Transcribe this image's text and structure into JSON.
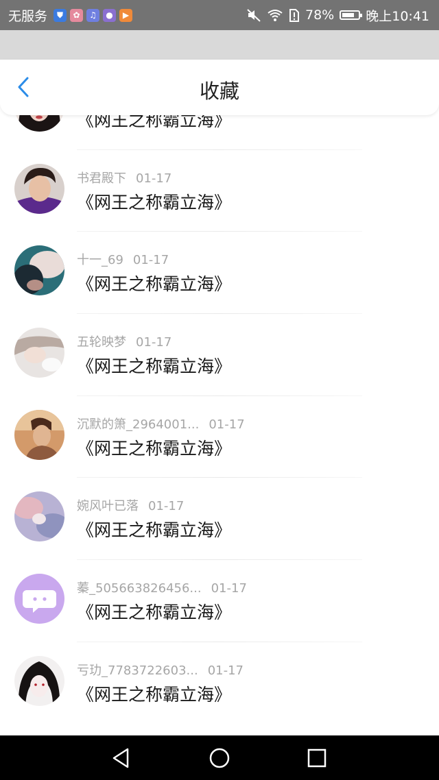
{
  "status_bar": {
    "carrier": "无服务",
    "battery": "78%",
    "time": "晚上10:41",
    "battery_level": 0.78
  },
  "header": {
    "title": "收藏"
  },
  "items": [
    {
      "name": "",
      "date": "",
      "title": "《网王之称霸立海》",
      "avatar": "portrait-dark-hair"
    },
    {
      "name": "书君殿下",
      "date": "01-17",
      "title": "《网王之称霸立海》",
      "avatar": "portrait-young-man"
    },
    {
      "name": "十一_69",
      "date": "01-17",
      "title": "《网王之称霸立海》",
      "avatar": "portrait-teal"
    },
    {
      "name": "五轮映梦",
      "date": "01-17",
      "title": "《网王之称霸立海》",
      "avatar": "portrait-sleeping"
    },
    {
      "name": "沉默的箫_2964001...",
      "date": "01-17",
      "title": "《网王之称霸立海》",
      "avatar": "portrait-warm"
    },
    {
      "name": "婉风叶已落",
      "date": "01-17",
      "title": "《网王之称霸立海》",
      "avatar": "portrait-pastel"
    },
    {
      "name": "蓁_505663826456...",
      "date": "01-17",
      "title": "《网王之称霸立海》",
      "avatar": "chat-bubble-icon"
    },
    {
      "name": "亏玏_7783722603...",
      "date": "01-17",
      "title": "《网王之称霸立海》",
      "avatar": "portrait-anime"
    }
  ],
  "colors": {
    "status_bar": "#737373",
    "back_arrow": "#2b8ce8",
    "meta_text": "#a6a6a6",
    "title_text": "#1a1a1a",
    "nav_bar": "#000000"
  }
}
